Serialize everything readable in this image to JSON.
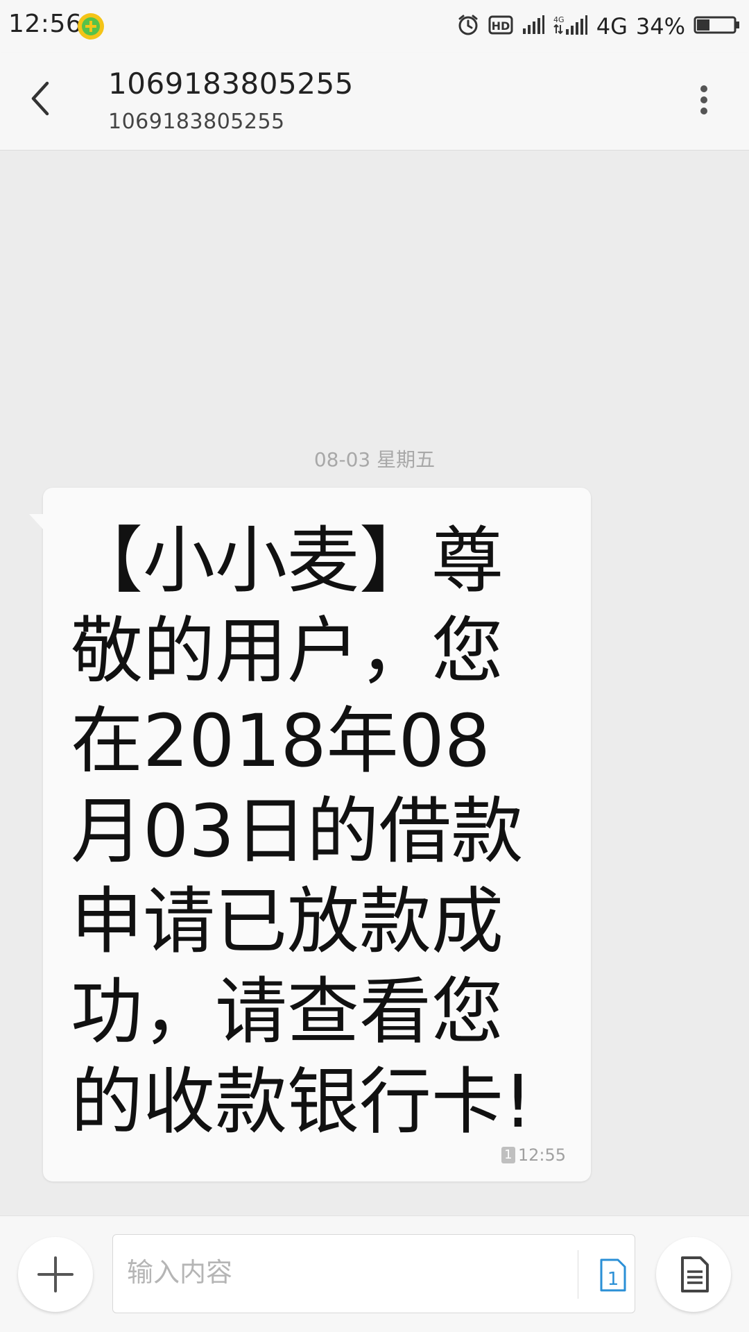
{
  "status_bar": {
    "time": "12:56",
    "network_label": "4G",
    "battery_percent": "34%",
    "battery_level": 0.34,
    "icons": [
      "alarm-icon",
      "hd-icon",
      "signal-icon",
      "signal-4g-icon",
      "battery-icon"
    ]
  },
  "header": {
    "title": "1069183805255",
    "subtitle": "1069183805255"
  },
  "conversation": {
    "date_divider": "08-03  星期五",
    "messages": [
      {
        "text": "【小小麦】尊敬的用户，您在2018年08月03日的借款申请已放款成功，请查看您的收款银行卡!",
        "sim": "1",
        "time": "12:55"
      }
    ]
  },
  "composer": {
    "placeholder": "输入内容",
    "value": "",
    "sim_label": "1"
  },
  "colors": {
    "background": "#ececec",
    "bar": "#f7f7f7",
    "bubble": "#fafafa",
    "accent": "#2a8fd6",
    "app_icon": "#f4c418"
  }
}
